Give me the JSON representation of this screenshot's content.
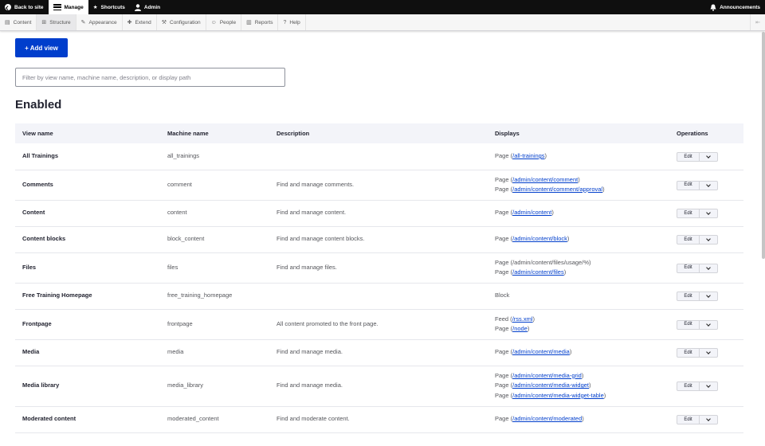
{
  "toolbar": {
    "back": "Back to site",
    "manage": "Manage",
    "shortcuts": "Shortcuts",
    "admin": "Admin",
    "announcements": "Announcements"
  },
  "tray": {
    "items": [
      "Content",
      "Structure",
      "Appearance",
      "Extend",
      "Configuration",
      "People",
      "Reports",
      "Help"
    ]
  },
  "page": {
    "add_label": "+ Add view",
    "filter_placeholder": "Filter by view name, machine name, description, or display path",
    "section_heading": "Enabled"
  },
  "table": {
    "headers": [
      "View name",
      "Machine name",
      "Description",
      "Displays",
      "Operations"
    ],
    "edit_label": "Edit",
    "rows": [
      {
        "name": "All Trainings",
        "machine": "all_trainings",
        "desc": "",
        "displays": [
          {
            "prefix": "Page (",
            "link": "/all-trainings",
            "suffix": ")"
          }
        ]
      },
      {
        "name": "Comments",
        "machine": "comment",
        "desc": "Find and manage comments.",
        "displays": [
          {
            "prefix": "Page (",
            "link": "/admin/content/comment",
            "suffix": ")"
          },
          {
            "prefix": "Page (",
            "link": "/admin/content/comment/approval",
            "suffix": ")"
          }
        ]
      },
      {
        "name": "Content",
        "machine": "content",
        "desc": "Find and manage content.",
        "displays": [
          {
            "prefix": "Page (",
            "link": "/admin/content",
            "suffix": ")"
          }
        ]
      },
      {
        "name": "Content blocks",
        "machine": "block_content",
        "desc": "Find and manage content blocks.",
        "displays": [
          {
            "prefix": "Page (",
            "link": "/admin/content/block",
            "suffix": ")"
          }
        ]
      },
      {
        "name": "Files",
        "machine": "files",
        "desc": "Find and manage files.",
        "displays": [
          {
            "prefix": "Page (/admin/content/files/usage/%)",
            "link": "",
            "suffix": ""
          },
          {
            "prefix": "Page (",
            "link": "/admin/content/files",
            "suffix": ")"
          }
        ]
      },
      {
        "name": "Free Training Homepage",
        "machine": "free_training_homepage",
        "desc": "",
        "displays": [
          {
            "prefix": "Block",
            "link": "",
            "suffix": ""
          }
        ]
      },
      {
        "name": "Frontpage",
        "machine": "frontpage",
        "desc": "All content promoted to the front page.",
        "displays": [
          {
            "prefix": "Feed (",
            "link": "/rss.xml",
            "suffix": ")"
          },
          {
            "prefix": "Page (",
            "link": "/node",
            "suffix": ")"
          }
        ]
      },
      {
        "name": "Media",
        "machine": "media",
        "desc": "Find and manage media.",
        "displays": [
          {
            "prefix": "Page (",
            "link": "/admin/content/media",
            "suffix": ")"
          }
        ]
      },
      {
        "name": "Media library",
        "machine": "media_library",
        "desc": "Find and manage media.",
        "displays": [
          {
            "prefix": "Page (",
            "link": "/admin/content/media-grid",
            "suffix": ")"
          },
          {
            "prefix": "Page (",
            "link": "/admin/content/media-widget",
            "suffix": ")"
          },
          {
            "prefix": "Page (",
            "link": "/admin/content/media-widget-table",
            "suffix": ")"
          }
        ]
      },
      {
        "name": "Moderated content",
        "machine": "moderated_content",
        "desc": "Find and moderate content.",
        "displays": [
          {
            "prefix": "Page (",
            "link": "/admin/content/moderated",
            "suffix": ")"
          }
        ]
      }
    ]
  }
}
